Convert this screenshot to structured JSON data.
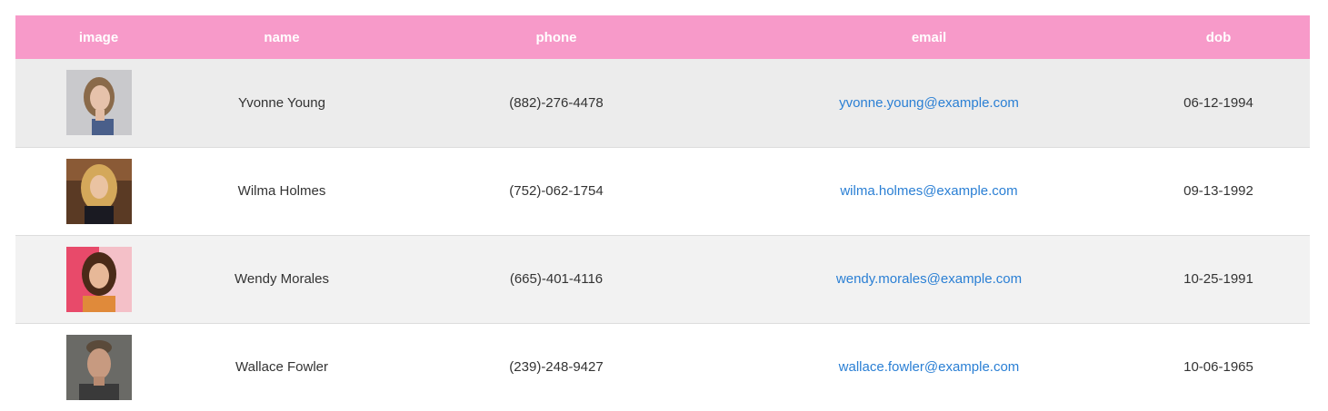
{
  "table": {
    "headers": {
      "image": "image",
      "name": "name",
      "phone": "phone",
      "email": "email",
      "dob": "dob"
    },
    "rows": [
      {
        "name": "Yvonne Young",
        "phone": "(882)-276-4478",
        "email": "yvonne.young@example.com",
        "dob": "06-12-1994"
      },
      {
        "name": "Wilma Holmes",
        "phone": "(752)-062-1754",
        "email": "wilma.holmes@example.com",
        "dob": "09-13-1992"
      },
      {
        "name": "Wendy Morales",
        "phone": "(665)-401-4116",
        "email": "wendy.morales@example.com",
        "dob": "10-25-1991"
      },
      {
        "name": "Wallace Fowler",
        "phone": "(239)-248-9427",
        "email": "wallace.fowler@example.com",
        "dob": "10-06-1965"
      }
    ]
  },
  "colors": {
    "header_bg": "#f79ac9",
    "header_text": "#ffffff",
    "link": "#2a7fd4"
  }
}
